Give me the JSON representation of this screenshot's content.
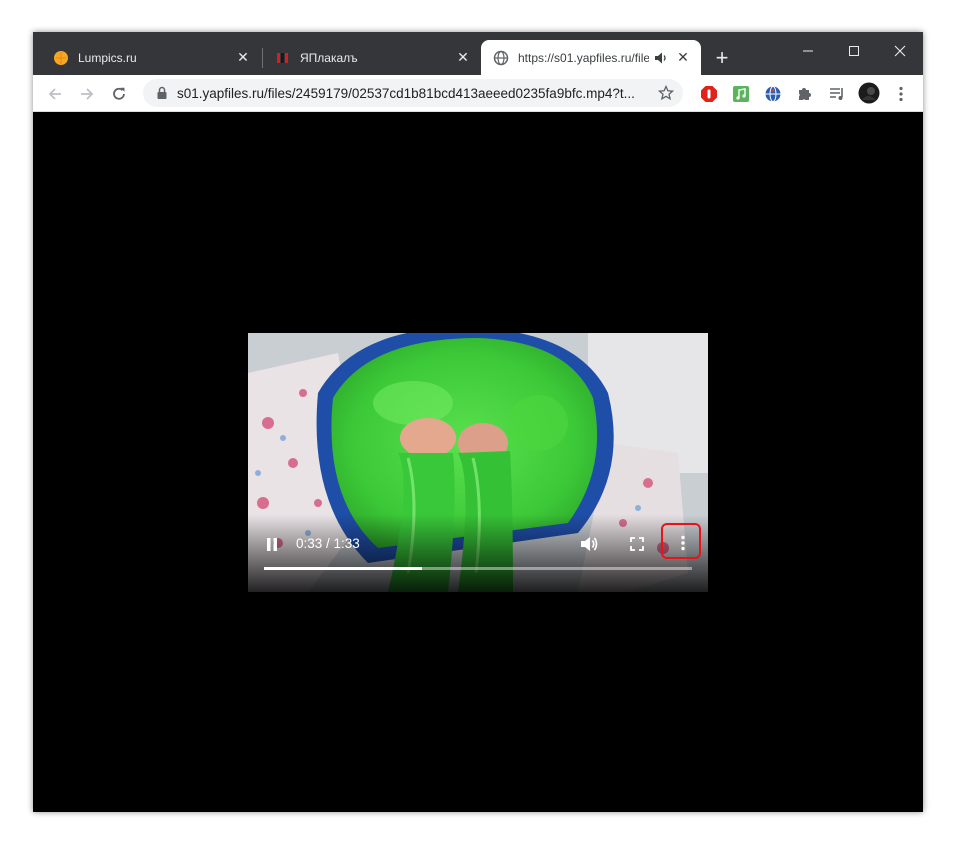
{
  "tabs": [
    {
      "title": "Lumpics.ru",
      "favicon": "orange-circle-favicon",
      "active": false
    },
    {
      "title": "ЯПлакалъ",
      "favicon": "yaplakal-favicon",
      "active": false
    },
    {
      "title": "https://s01.yapfiles.ru/file",
      "favicon": "globe-favicon",
      "active": true,
      "audio": "speaker-icon"
    }
  ],
  "toolbar": {
    "url": "s01.yapfiles.ru/files/2459179/02537cd1b81bcd413aeeed0235fa9bfc.mp4?t...",
    "extensions": [
      "adblock-icon",
      "music-icon",
      "vpn-globe-icon",
      "puzzle-extensions-icon",
      "media-queue-icon",
      "profile-avatar"
    ]
  },
  "player": {
    "time": "0:33 / 1:33",
    "progress_fraction": 0.368,
    "state": "playing"
  },
  "colors": {
    "titlebar": "#35363a",
    "highlight": "#e8141b",
    "slime": "#3fd23c"
  }
}
